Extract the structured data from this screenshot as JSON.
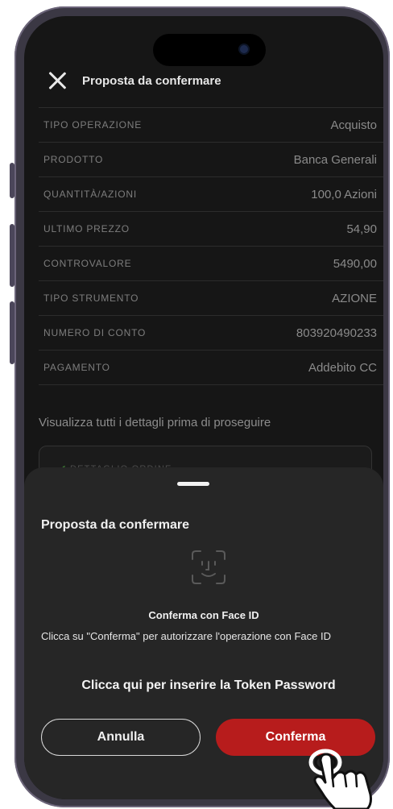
{
  "header": {
    "title": "Proposta da confermare"
  },
  "rows": [
    {
      "label": "TIPO OPERAZIONE",
      "value": "Acquisto"
    },
    {
      "label": "PRODOTTO",
      "value": "Banca Generali"
    },
    {
      "label": "QUANTITÀ/AZIONI",
      "value": "100,0 Azioni"
    },
    {
      "label": "ULTIMO PREZZO",
      "value": "54,90"
    },
    {
      "label": "CONTROVALORE",
      "value": "5490,00"
    },
    {
      "label": "TIPO STRUMENTO",
      "value": "AZIONE"
    },
    {
      "label": "NUMERO DI CONTO",
      "value": "803920490233"
    },
    {
      "label": "PAGAMENTO",
      "value": "Addebito CC"
    }
  ],
  "details": {
    "text": "Visualizza tutti i dettagli prima di proseguire",
    "box_label": "DETTAGLIO ORDINE"
  },
  "sheet": {
    "title": "Proposta da confermare",
    "faceid_title": "Conferma con Face ID",
    "faceid_desc": "Clicca su \"Conferma\" per autorizzare l'operazione con Face ID",
    "token_link": "Clicca qui per inserire la Token Password",
    "cancel_label": "Annulla",
    "confirm_label": "Conferma"
  },
  "icons": {
    "close": "close-icon",
    "faceid": "face-id-icon",
    "check": "check-icon",
    "pointer": "hand-pointer-icon"
  },
  "colors": {
    "accent": "#b71c1c",
    "background": "#161616",
    "sheet": "#262626"
  }
}
